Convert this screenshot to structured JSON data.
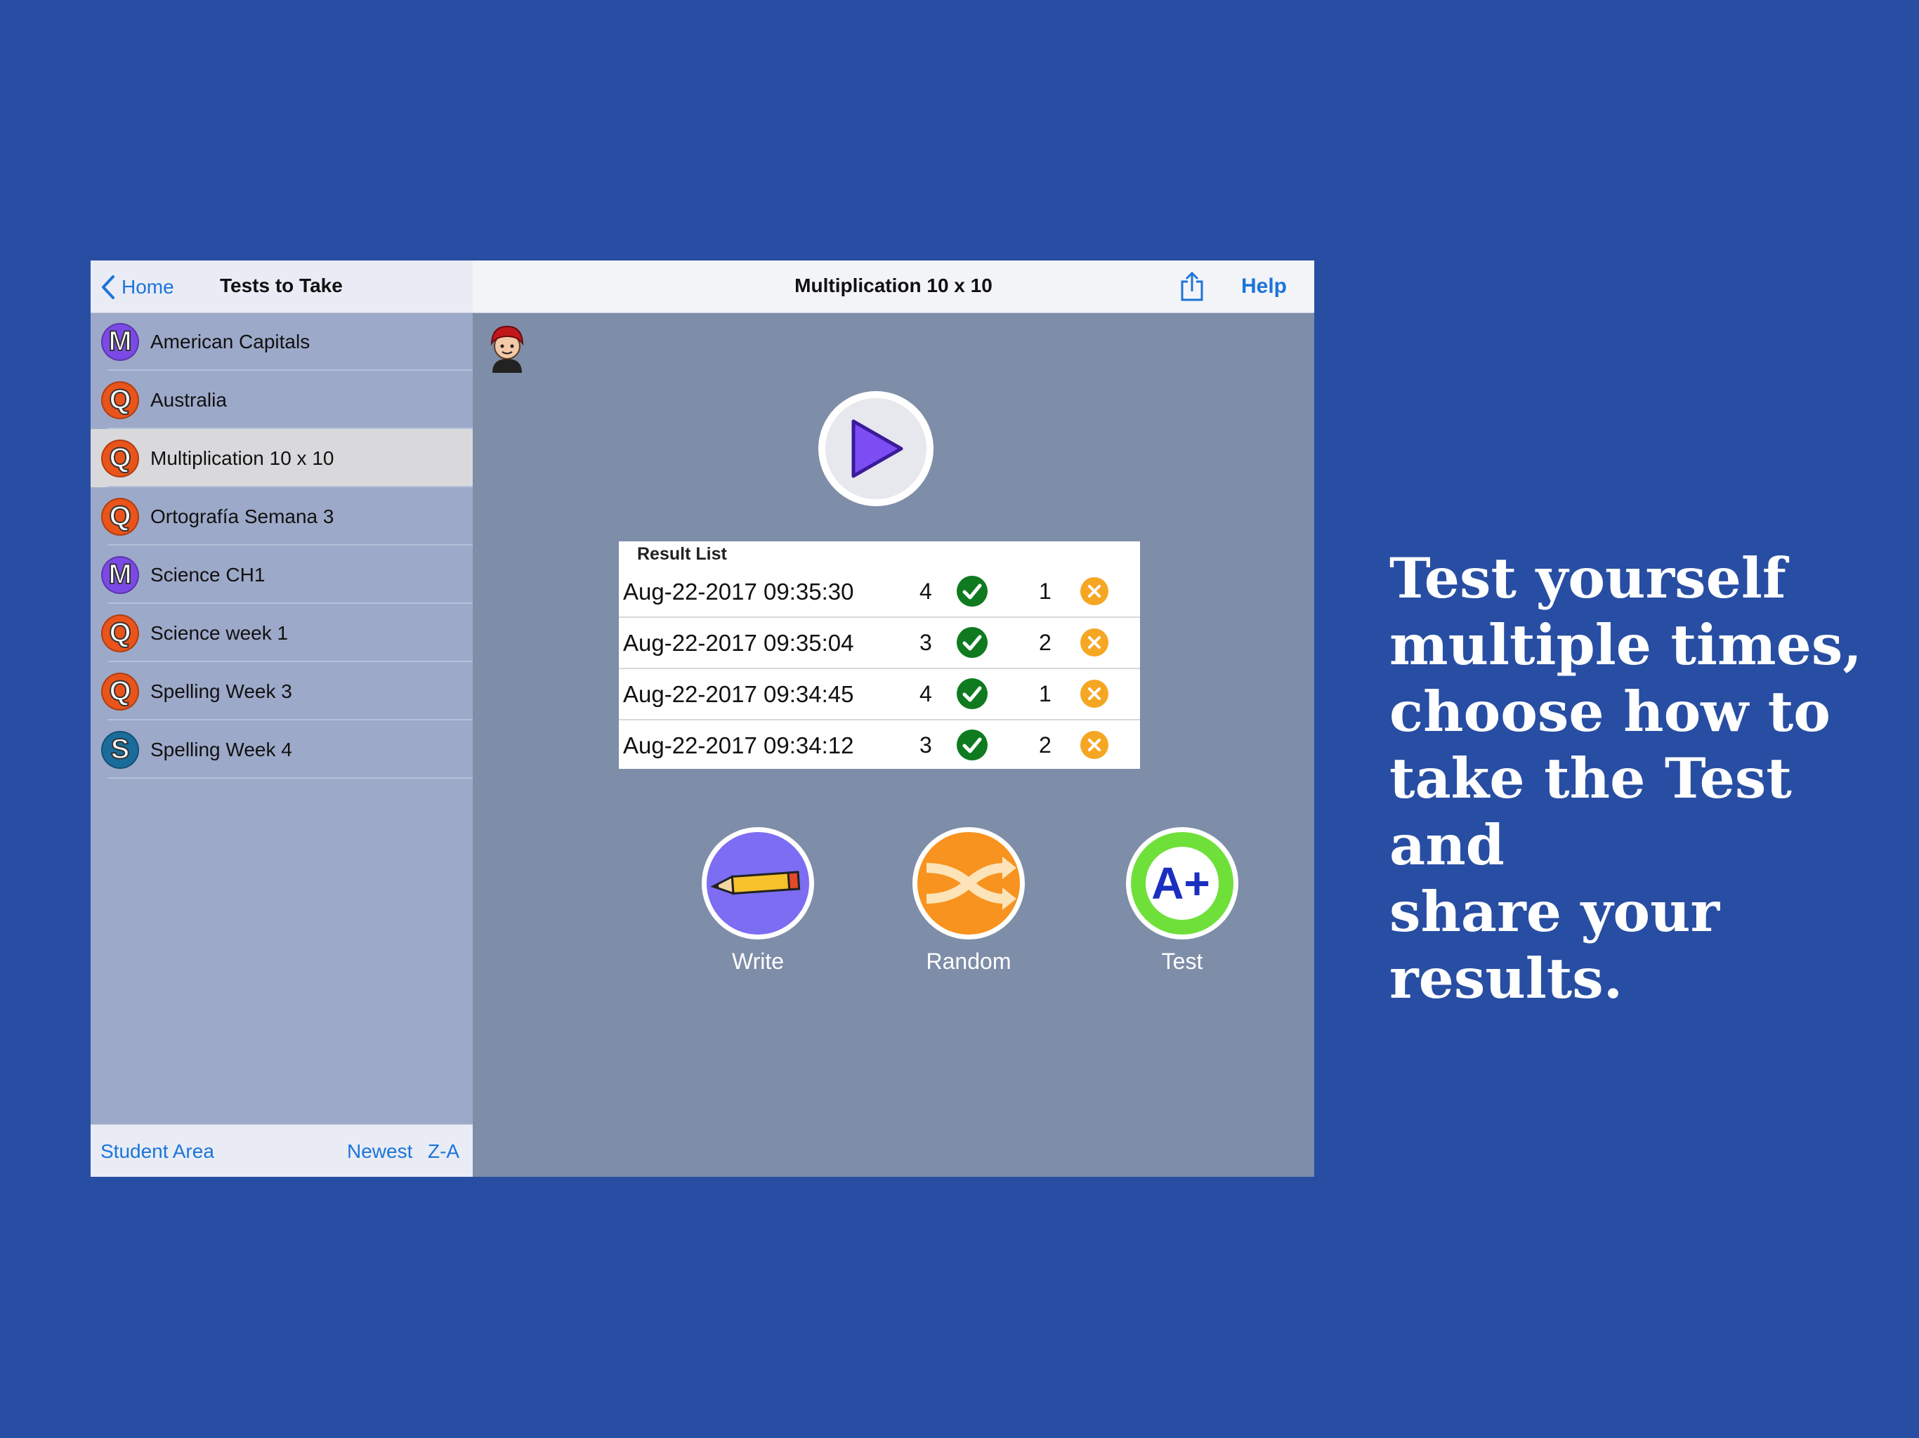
{
  "sidebar": {
    "back_label": "Home",
    "title": "Tests to Take",
    "items": [
      {
        "badge": "M",
        "badge_type": "m",
        "label": "American Capitals"
      },
      {
        "badge": "Q",
        "badge_type": "q",
        "label": "Australia"
      },
      {
        "badge": "Q",
        "badge_type": "q",
        "label": "Multiplication 10 x 10",
        "selected": true
      },
      {
        "badge": "Q",
        "badge_type": "q",
        "label": "Ortografía Semana 3"
      },
      {
        "badge": "M",
        "badge_type": "m",
        "label": "Science CH1"
      },
      {
        "badge": "Q",
        "badge_type": "q",
        "label": "Science week 1"
      },
      {
        "badge": "Q",
        "badge_type": "q",
        "label": "Spelling Week 3"
      },
      {
        "badge": "S",
        "badge_type": "s",
        "label": "Spelling Week 4"
      }
    ],
    "footer": {
      "student_area": "Student Area",
      "newest": "Newest",
      "za": "Z-A"
    }
  },
  "main": {
    "title": "Multiplication 10 x 10",
    "help_label": "Help",
    "result_list": {
      "title": "Result List",
      "rows": [
        {
          "date": "Aug-22-2017 09:35:30",
          "correct": "4",
          "wrong": "1"
        },
        {
          "date": "Aug-22-2017 09:35:04",
          "correct": "3",
          "wrong": "2"
        },
        {
          "date": "Aug-22-2017 09:34:45",
          "correct": "4",
          "wrong": "1"
        },
        {
          "date": "Aug-22-2017 09:34:12",
          "correct": "3",
          "wrong": "2"
        }
      ]
    },
    "modes": {
      "write": "Write",
      "random": "Random",
      "test": "Test",
      "test_badge": "A+"
    }
  },
  "tagline": [
    "Test yourself",
    "multiple times,",
    "choose how to",
    "take the Test and",
    "share your results."
  ],
  "colors": {
    "background": "#284ea3",
    "accent": "#1c74d8",
    "correct": "#0f7a1f",
    "wrong": "#f5a623"
  }
}
